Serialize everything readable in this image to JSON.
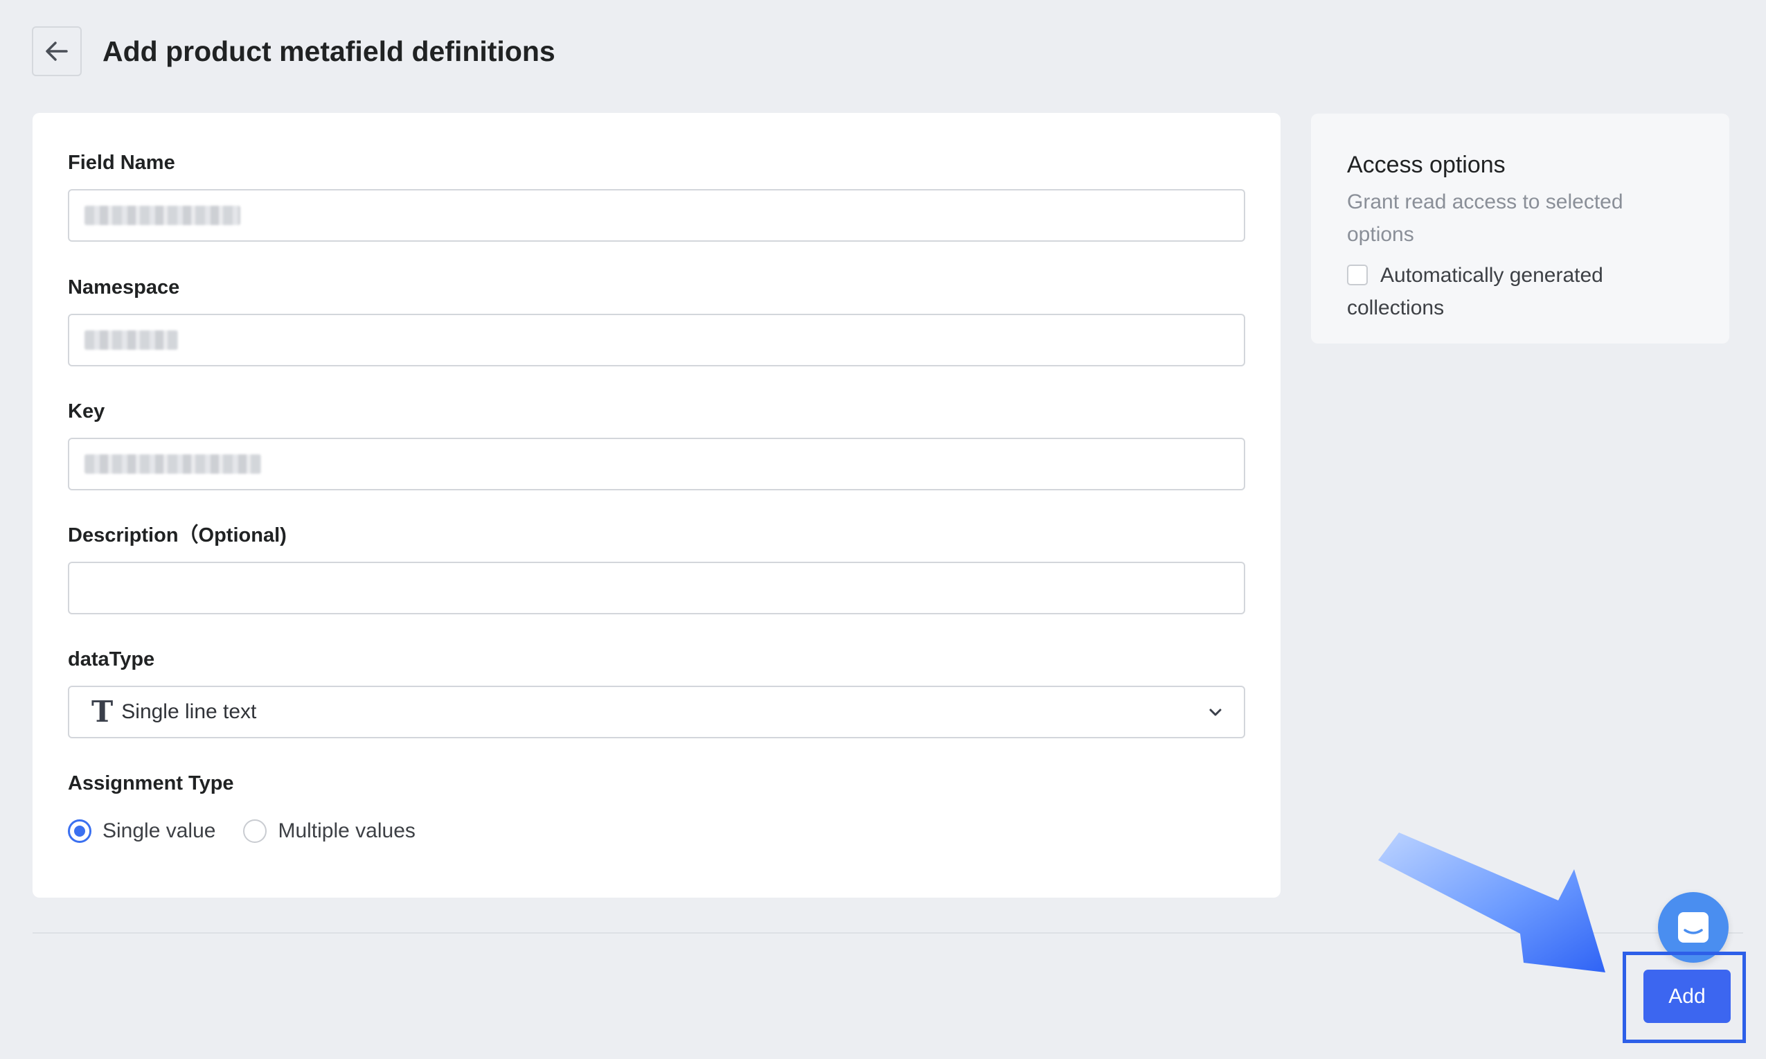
{
  "header": {
    "title": "Add product metafield definitions"
  },
  "form": {
    "field_name": {
      "label": "Field Name",
      "value": ""
    },
    "namespace": {
      "label": "Namespace",
      "value": ""
    },
    "key": {
      "label": "Key",
      "value": ""
    },
    "description": {
      "label": "Description（Optional)",
      "value": ""
    },
    "data_type": {
      "label": "dataType",
      "icon": "T",
      "selected": "Single line text"
    },
    "assignment_type": {
      "label": "Assignment Type",
      "options": [
        {
          "label": "Single value",
          "checked": true
        },
        {
          "label": "Multiple values",
          "checked": false
        }
      ]
    }
  },
  "access_options": {
    "title": "Access options",
    "subtitle": "Grant read access to selected options",
    "checkbox_label": "Automatically generated collections",
    "checked": false
  },
  "footer": {
    "add_label": "Add"
  },
  "colors": {
    "accent": "#3c66f0",
    "radio": "#3b70f0",
    "chat": "#4a8ef0",
    "highlight": "#2d5fe8"
  },
  "icons": [
    "arrow-left-icon",
    "chevron-down-icon",
    "text-type-icon",
    "chat-icon",
    "pointer-arrow-icon"
  ]
}
